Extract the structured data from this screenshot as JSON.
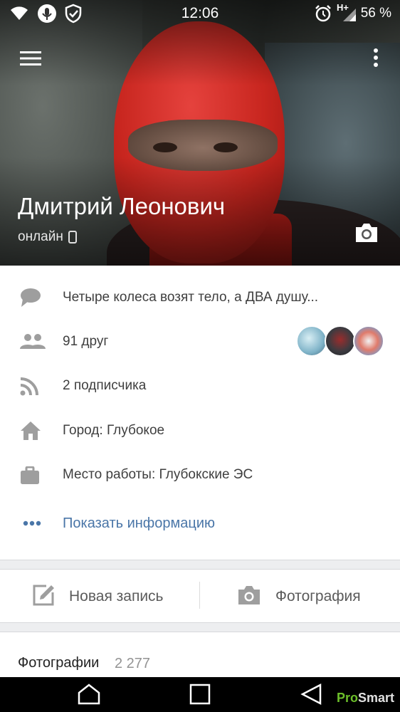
{
  "status_bar": {
    "time": "12:06",
    "network_label": "H+",
    "battery_text": "56 %",
    "icons": [
      "wifi-icon",
      "microphone-icon",
      "shield-check-icon",
      "alarm-icon",
      "signal-icon"
    ]
  },
  "profile": {
    "name": "Дмитрий Леонович",
    "status": "онлайн",
    "icons": [
      "menu-icon",
      "more-vertical-icon",
      "phone-icon",
      "camera-icon"
    ]
  },
  "info": {
    "quote": "Четыре колеса возят тело, а ДВА душу...",
    "friends": "91 друг",
    "followers": "2 подписчика",
    "city": "Город: Глубокое",
    "work": "Место работы: Глубокские ЭС",
    "show_more": "Показать информацию"
  },
  "actions": {
    "new_post": "Новая запись",
    "photo": "Фотография"
  },
  "photos": {
    "title": "Фотографии",
    "count": "2 277"
  },
  "watermark": {
    "pro": "Pro",
    "smart": "Smart"
  },
  "colors": {
    "accent": "#4a76a8",
    "icon": "#9e9e9e",
    "text": "#3f3f3f"
  }
}
